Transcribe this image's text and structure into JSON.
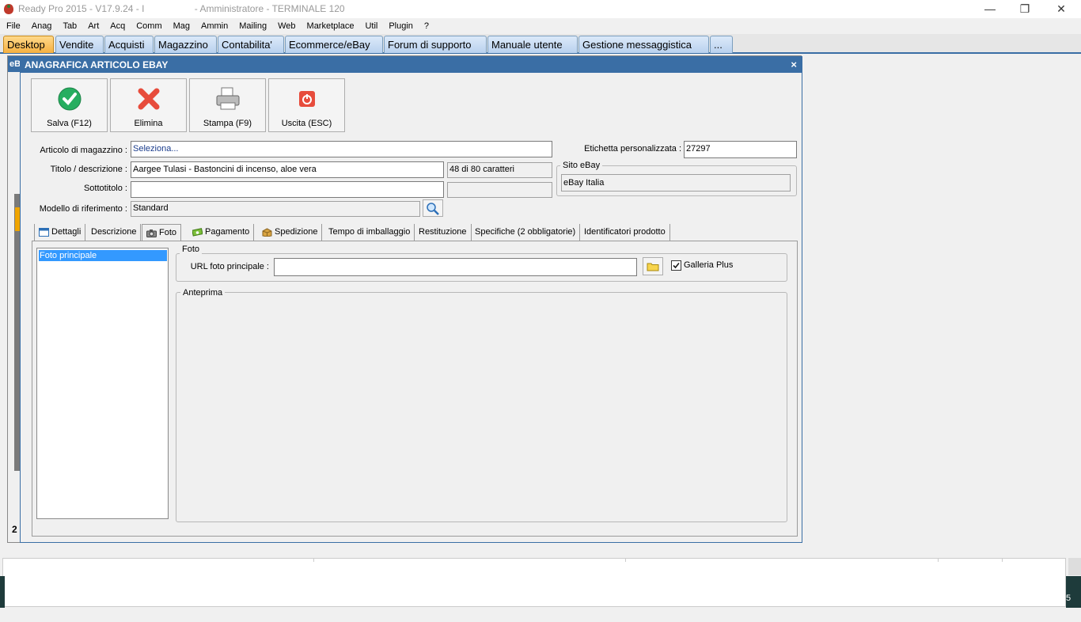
{
  "window": {
    "title": "Ready Pro 2015 - V17.9.24 - I                   - Amministratore - TERMINALE 120",
    "minimize": "—",
    "restore": "❐",
    "close": "✕"
  },
  "menu": [
    "File",
    "Anag",
    "Tab",
    "Art",
    "Acq",
    "Comm",
    "Mag",
    "Ammin",
    "Mailing",
    "Web",
    "Marketplace",
    "Util",
    "Plugin",
    "?"
  ],
  "main_tabs": [
    "Desktop",
    "Vendite",
    "Acquisti",
    "Magazzino",
    "Contabilita'",
    "Ecommerce/eBay",
    "Forum di supporto",
    "Manuale utente",
    "Gestione messaggistica",
    "..."
  ],
  "background": {
    "strip_label": "eB",
    "bottom_label": "2",
    "right_digit": "5"
  },
  "dialog": {
    "title": "ANAGRAFICA ARTICOLO EBAY",
    "close": "×",
    "toolbar": {
      "save": "Salva (F12)",
      "delete": "Elimina",
      "print": "Stampa (F9)",
      "exit": "Uscita (ESC)"
    },
    "labels": {
      "articolo": "Articolo di magazzino :",
      "titolo": "Titolo / descrizione :",
      "sottotitolo": "Sottotitolo :",
      "modello": "Modello di riferimento :",
      "etichetta": "Etichetta personalizzata :",
      "sito": "Sito eBay"
    },
    "values": {
      "articolo": "Seleziona...",
      "titolo": "Aargee Tulasi - Bastoncini di incenso, aloe vera",
      "char_count": "48 di 80 caratteri",
      "sottotitolo": "",
      "modello": "Standard",
      "etichetta": "27297",
      "sito": "eBay Italia"
    },
    "subtabs": [
      "Dettagli",
      "Descrizione",
      "Foto",
      "Pagamento",
      "Spedizione",
      "Tempo di imballaggio",
      "Restituzione",
      "Specifiche (2 obbligatorie)",
      "Identificatori prodotto"
    ],
    "foto": {
      "list_item": "Foto principale",
      "group_label": "Foto",
      "url_label": "URL foto principale :",
      "url_value": "",
      "galleria_label": "Galleria Plus",
      "galleria_checked": true,
      "anteprima_label": "Anteprima"
    }
  },
  "colors": {
    "accent": "#3a6ea5",
    "active_tab": "#f5b041",
    "selection": "#3399ff"
  }
}
